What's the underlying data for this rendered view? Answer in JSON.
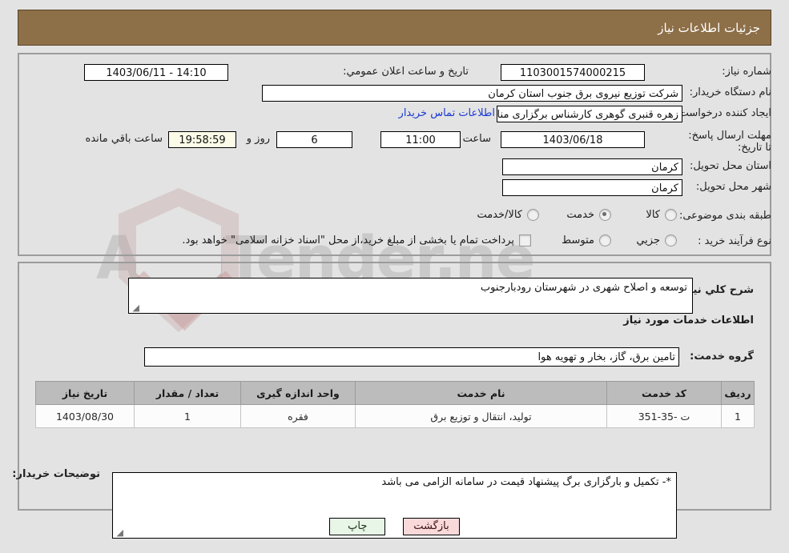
{
  "header": {
    "title": "جزئیات اطلاعات نیاز"
  },
  "colors": {
    "header_bg": "#8d6f48",
    "page_bg": "#e3e3e3",
    "link": "#1a39d2",
    "table_header_bg": "#bcbcbc",
    "print_button_bg": "#e8f6e8",
    "back_button_bg": "#fad9da",
    "countdown_bg": "#fbfbe8"
  },
  "watermark": {
    "text": "AriaTender.ne"
  },
  "form": {
    "need_number": {
      "label": "شماره نیاز:",
      "value": "1103001574000215"
    },
    "buyer_org": {
      "label": "نام دستگاه خریدار:",
      "value": "شرکت توزیع نیروی برق جنوب استان کرمان"
    },
    "request_creator": {
      "label": "ایجاد کننده درخواست:",
      "value": "زهره قنبری گوهری کارشناس برگزاری مناقصات و مزایده ها شرکت توزیع نیروی بر",
      "contact_link": "اطلاعات تماس خریدار"
    },
    "announce_datetime": {
      "label": "تاریخ و ساعت اعلان عمومي:",
      "value": "14:10 - 1403/06/11"
    },
    "response_deadline": {
      "label": "مهلت ارسال پاسخ: تا تاریخ:",
      "date": "1403/06/18",
      "time_label": "ساعت",
      "time": "11:00",
      "days": "6",
      "days_label": "روز و",
      "countdown": "19:58:59",
      "countdown_label": "ساعت باقي مانده"
    },
    "delivery_province": {
      "label": "استان محل تحویل:",
      "value": "کرمان"
    },
    "delivery_city": {
      "label": "شهر محل تحویل:",
      "value": "کرمان"
    },
    "category": {
      "label": "طبقه بندی موضوعی:",
      "options": [
        {
          "label": "کالا",
          "selected": false
        },
        {
          "label": "خدمت",
          "selected": true
        },
        {
          "label": "کالا/خدمت",
          "selected": false
        }
      ]
    },
    "purchase_type": {
      "label": "نوع فرآیند خرید :",
      "options": [
        {
          "label": "جزیي",
          "selected": false
        },
        {
          "label": "متوسط",
          "selected": false
        }
      ],
      "treasury_checkbox": {
        "checked": false,
        "label": "پرداخت تمام یا بخشی از مبلغ خرید،از محل \"اسناد خزانه اسلامی\" خواهد بود."
      }
    },
    "general_description": {
      "label": "شرح کلي نیاز:",
      "value": "توسعه و اصلاح شهری در شهرستان رودبارجنوب"
    },
    "services_section_title": "اطلاعات خدمات مورد نیاز",
    "service_group": {
      "label": "گروه خدمت:",
      "value": "تامین برق، گاز، بخار و تهویه هوا"
    },
    "buyer_notes": {
      "label": "توضیحات خریدار:",
      "value": "*- تکمیل و بارگزاری برگ پیشنهاد قیمت در سامانه الزامی می باشد"
    }
  },
  "items_table": {
    "columns": [
      "ردیف",
      "کد خدمت",
      "نام خدمت",
      "واحد اندازه گیری",
      "تعداد / مقدار",
      "تاریخ نیاز"
    ],
    "rows": [
      {
        "index": "1",
        "service_code": "ت -35-351",
        "service_name": "تولید، انتقال و توزیع برق",
        "unit": "فقره",
        "quantity": "1",
        "need_date": "1403/08/30"
      }
    ]
  },
  "buttons": {
    "print": "چاپ",
    "back": "بازگشت"
  }
}
